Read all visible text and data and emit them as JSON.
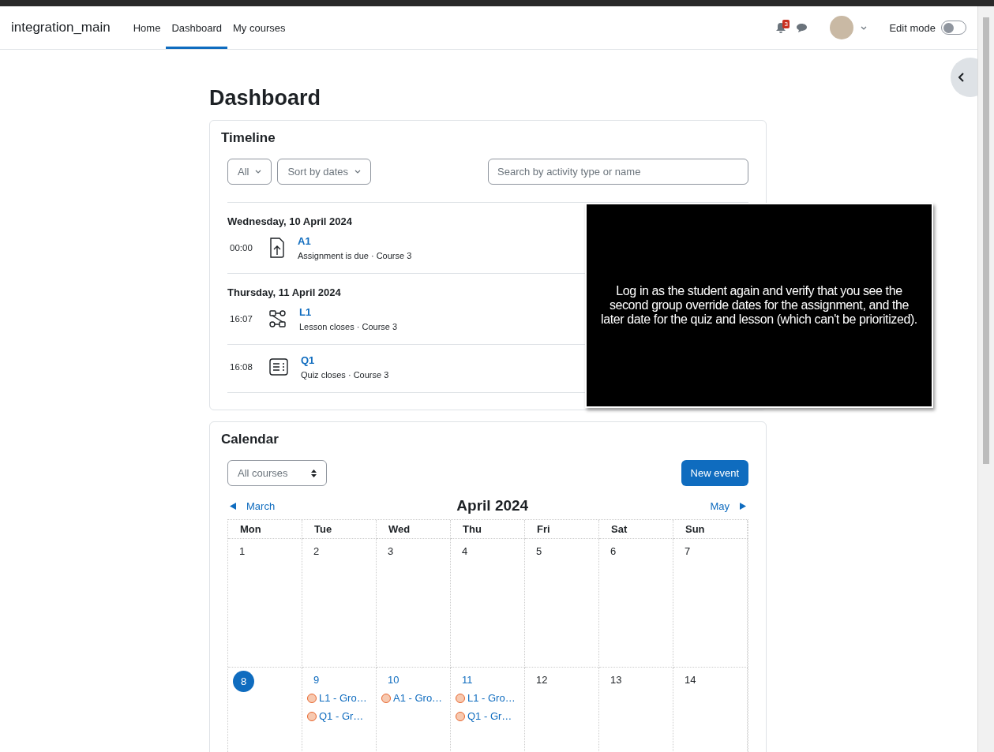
{
  "navbar": {
    "site_name": "integration_main",
    "links": [
      {
        "label": "Home",
        "selected": false
      },
      {
        "label": "Dashboard",
        "selected": true
      },
      {
        "label": "My courses",
        "selected": false
      }
    ],
    "notification_count": "3",
    "edit_mode": {
      "label": "Edit mode",
      "on": false
    }
  },
  "page_title": "Dashboard",
  "timeline": {
    "title": "Timeline",
    "filter": "All",
    "sort": "Sort by dates",
    "search": {
      "placeholder": "Search by activity type or name"
    },
    "groups": [
      {
        "date": "Wednesday, 10 April 2024",
        "items": [
          {
            "time": "00:00",
            "kind": "assign",
            "name": "A1",
            "description": "Assignment is due · Course 3"
          }
        ]
      },
      {
        "date": "Thursday, 11 April 2024",
        "items": [
          {
            "time": "16:07",
            "kind": "lesson",
            "name": "L1",
            "description": "Lesson closes · Course 3"
          },
          {
            "time": "16:08",
            "kind": "quiz",
            "name": "Q1",
            "description": "Quiz closes · Course 3"
          }
        ]
      }
    ]
  },
  "overlay": {
    "text": "Log in as the student again and verify that you see the second group override dates for the assignment, and the later date for the quiz and lesson (which can't be prioritized)."
  },
  "calendar": {
    "title": "Calendar",
    "course_select": "All courses",
    "new_event": "New event",
    "prev": "March",
    "month": "April 2024",
    "next": "May",
    "weekdays": [
      "Mon",
      "Tue",
      "Wed",
      "Thu",
      "Fri",
      "Sat",
      "Sun"
    ],
    "weeks": [
      [
        {
          "day": "1",
          "selected": false
        },
        {
          "day": "2",
          "selected": false
        },
        {
          "day": "3",
          "selected": false
        },
        {
          "day": "4",
          "selected": false
        },
        {
          "day": "5",
          "selected": false
        },
        {
          "day": "6",
          "selected": false
        },
        {
          "day": "7",
          "selected": false
        }
      ],
      [
        {
          "day": "8",
          "selected": true
        },
        {
          "day": "9",
          "selected": false,
          "events": [
            {
              "label": "L1 - Gro…",
              "color": "#f7c9b0"
            },
            {
              "label": "Q1 - Gr…",
              "color": "#f7c9b0"
            }
          ]
        },
        {
          "day": "10",
          "selected": false,
          "events": [
            {
              "label": "A1 - Gro…",
              "color": "#f7c9b0"
            }
          ]
        },
        {
          "day": "11",
          "selected": false,
          "events": [
            {
              "label": "L1 - Gro…",
              "color": "#f7c9b0"
            },
            {
              "label": "Q1 - Gr…",
              "color": "#f7c9b0"
            }
          ]
        },
        {
          "day": "12",
          "selected": false
        },
        {
          "day": "13",
          "selected": false
        },
        {
          "day": "14",
          "selected": false
        }
      ]
    ]
  }
}
